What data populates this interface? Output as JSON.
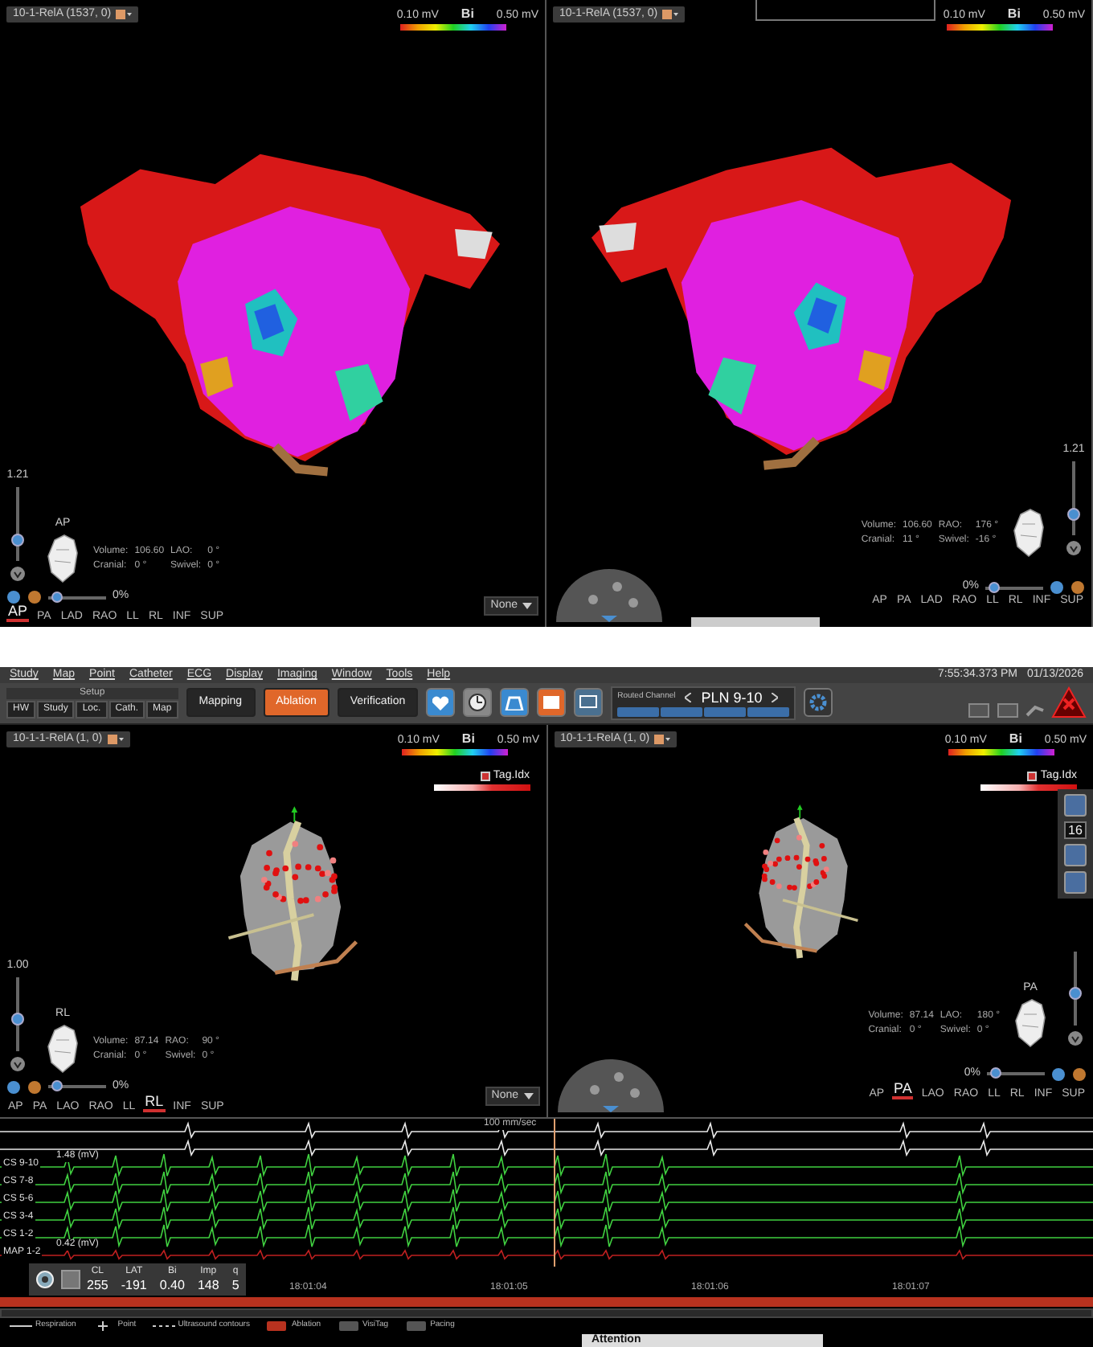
{
  "top_screen": {
    "views": [
      {
        "map_name": "10-1-RelA (1537, 0)",
        "scale_min": "0.10 mV",
        "scale_type": "Bi",
        "scale_max": "0.50 mV",
        "kind": "voltage",
        "zoom": "1.21",
        "zoom_slider": {
          "level": 0.3
        },
        "orientation_label": "AP",
        "stats": [
          {
            "label": "Volume:",
            "value": "106.60"
          },
          {
            "label": "LAO:",
            "value": "0 °"
          },
          {
            "label": "Cranial:",
            "value": "0 °"
          },
          {
            "label": "Swivel:",
            "value": "0 °"
          }
        ],
        "opacity_slider": {
          "level": 0.15
        },
        "opacity": "0%",
        "orientations": [
          {
            "label": "AP",
            "selected": true
          },
          {
            "label": "PA",
            "selected": false
          },
          {
            "label": "LAD",
            "selected": false
          },
          {
            "label": "RAO",
            "selected": false
          },
          {
            "label": "LL",
            "selected": false
          },
          {
            "label": "RL",
            "selected": false
          },
          {
            "label": "INF",
            "selected": false
          },
          {
            "label": "SUP",
            "selected": false
          }
        ],
        "dropdown": "None"
      },
      {
        "map_name": "10-1-RelA (1537, 0)",
        "scale_min": "0.10 mV",
        "scale_type": "Bi",
        "scale_max": "0.50 mV",
        "kind": "voltage",
        "zoom": "1.21",
        "zoom_slider": {
          "level": 0.3
        },
        "stats": [
          {
            "label": "Volume:",
            "value": "106.60"
          },
          {
            "label": "RAO:",
            "value": "176 °"
          },
          {
            "label": "Cranial:",
            "value": "11 °"
          },
          {
            "label": "Swivel:",
            "value": "-16 °"
          }
        ],
        "opacity_slider": {
          "level": 0.15
        },
        "opacity": "0%",
        "orientations": [
          {
            "label": "AP",
            "selected": false
          },
          {
            "label": "PA",
            "selected": false
          },
          {
            "label": "LAD",
            "selected": false
          },
          {
            "label": "RAO",
            "selected": false
          },
          {
            "label": "LL",
            "selected": false
          },
          {
            "label": "RL",
            "selected": false
          },
          {
            "label": "INF",
            "selected": false
          },
          {
            "label": "SUP",
            "selected": false
          }
        ]
      }
    ]
  },
  "bottom_screen": {
    "menu": [
      "Study",
      "Map",
      "Point",
      "Catheter",
      "ECG",
      "Display",
      "Imaging",
      "Window",
      "Tools",
      "Help"
    ],
    "clock": "7:55:34.373 PM",
    "date": "01/13/2026",
    "setup": {
      "title": "Setup",
      "tabs": [
        "HW",
        "Study",
        "Loc.",
        "Cath.",
        "Map"
      ]
    },
    "modes": [
      {
        "label": "Mapping",
        "selected": false
      },
      {
        "label": "Ablation",
        "selected": true
      },
      {
        "label": "Verification",
        "selected": false
      }
    ],
    "routed_channel": {
      "label": "Routed Channel",
      "value": "PLN 9-10"
    },
    "views": [
      {
        "map_name": "10-1-1-RelA (1, 0)",
        "scale_min": "0.10 mV",
        "scale_type": "Bi",
        "scale_max": "0.50 mV",
        "tag_index": {
          "label": "Tag.Idx",
          "checked": true
        },
        "kind": "tag",
        "zoom": "1.00",
        "zoom_slider": {
          "level": 0.45
        },
        "orientation_label": "RL",
        "stats": [
          {
            "label": "Volume:",
            "value": "87.14"
          },
          {
            "label": "RAO:",
            "value": "90 °"
          },
          {
            "label": "Cranial:",
            "value": "0 °"
          },
          {
            "label": "Swivel:",
            "value": "0 °"
          }
        ],
        "opacity_slider": {
          "level": 0.15
        },
        "opacity": "0%",
        "orientations": [
          {
            "label": "AP",
            "selected": false
          },
          {
            "label": "PA",
            "selected": false
          },
          {
            "label": "LAO",
            "selected": false
          },
          {
            "label": "RAO",
            "selected": false
          },
          {
            "label": "LL",
            "selected": false
          },
          {
            "label": "RL",
            "selected": true
          },
          {
            "label": "INF",
            "selected": false
          },
          {
            "label": "SUP",
            "selected": false
          }
        ],
        "dropdown": "None"
      },
      {
        "map_name": "10-1-1-RelA (1, 0)",
        "scale_min": "0.10 mV",
        "scale_type": "Bi",
        "scale_max": "0.50 mV",
        "tag_index": {
          "label": "Tag.Idx",
          "checked": true
        },
        "kind": "tag",
        "zoom_slider": {
          "level": 0.45
        },
        "orientation_label": "PA",
        "stats": [
          {
            "label": "Volume:",
            "value": "87.14"
          },
          {
            "label": "LAO:",
            "value": "180 °"
          },
          {
            "label": "Cranial:",
            "value": "0 °"
          },
          {
            "label": "Swivel:",
            "value": "0 °"
          }
        ],
        "opacity_slider": {
          "level": 0.15
        },
        "opacity": "0%",
        "orientations": [
          {
            "label": "AP",
            "selected": false
          },
          {
            "label": "PA",
            "selected": true
          },
          {
            "label": "LAO",
            "selected": false
          },
          {
            "label": "RAO",
            "selected": false
          },
          {
            "label": "LL",
            "selected": false
          },
          {
            "label": "RL",
            "selected": false
          },
          {
            "label": "INF",
            "selected": false
          },
          {
            "label": "SUP",
            "selected": false
          }
        ],
        "side_toolbar": {
          "value": "16"
        }
      }
    ],
    "ecg": {
      "speed": "100 mm/sec",
      "channels": [
        {
          "kind": "surface"
        },
        {
          "kind": "surface"
        },
        {
          "label": "CS 9-10",
          "scale": "1.48 (mV)",
          "kind": "cs"
        },
        {
          "label": "CS 7-8",
          "kind": "cs"
        },
        {
          "label": "CS 5-6",
          "kind": "cs"
        },
        {
          "label": "CS 3-4",
          "kind": "cs"
        },
        {
          "label": "CS 1-2",
          "kind": "cs"
        },
        {
          "label": "MAP 1-2",
          "scale": "0.42 (mV)",
          "kind": "map"
        }
      ],
      "info": [
        {
          "label": "CL",
          "value": "255"
        },
        {
          "label": "LAT",
          "value": "-191"
        },
        {
          "label": "Bi",
          "value": "0.40"
        },
        {
          "label": "Imp",
          "value": "148"
        },
        {
          "label": "q",
          "value": "5"
        }
      ],
      "times": [
        "18:01:04",
        "18:01:05",
        "18:01:06",
        "18:01:07"
      ]
    },
    "legend": [
      {
        "kind": "line",
        "label": "Respiration"
      },
      {
        "kind": "cross",
        "label": "Point"
      },
      {
        "kind": "dashed",
        "label": "Ultrasound contours"
      },
      {
        "kind": "ablation",
        "label": "Ablation"
      },
      {
        "kind": "tag",
        "label": "VisiTag"
      },
      {
        "kind": "tag",
        "label": "Pacing"
      }
    ],
    "attention": "Attention"
  }
}
